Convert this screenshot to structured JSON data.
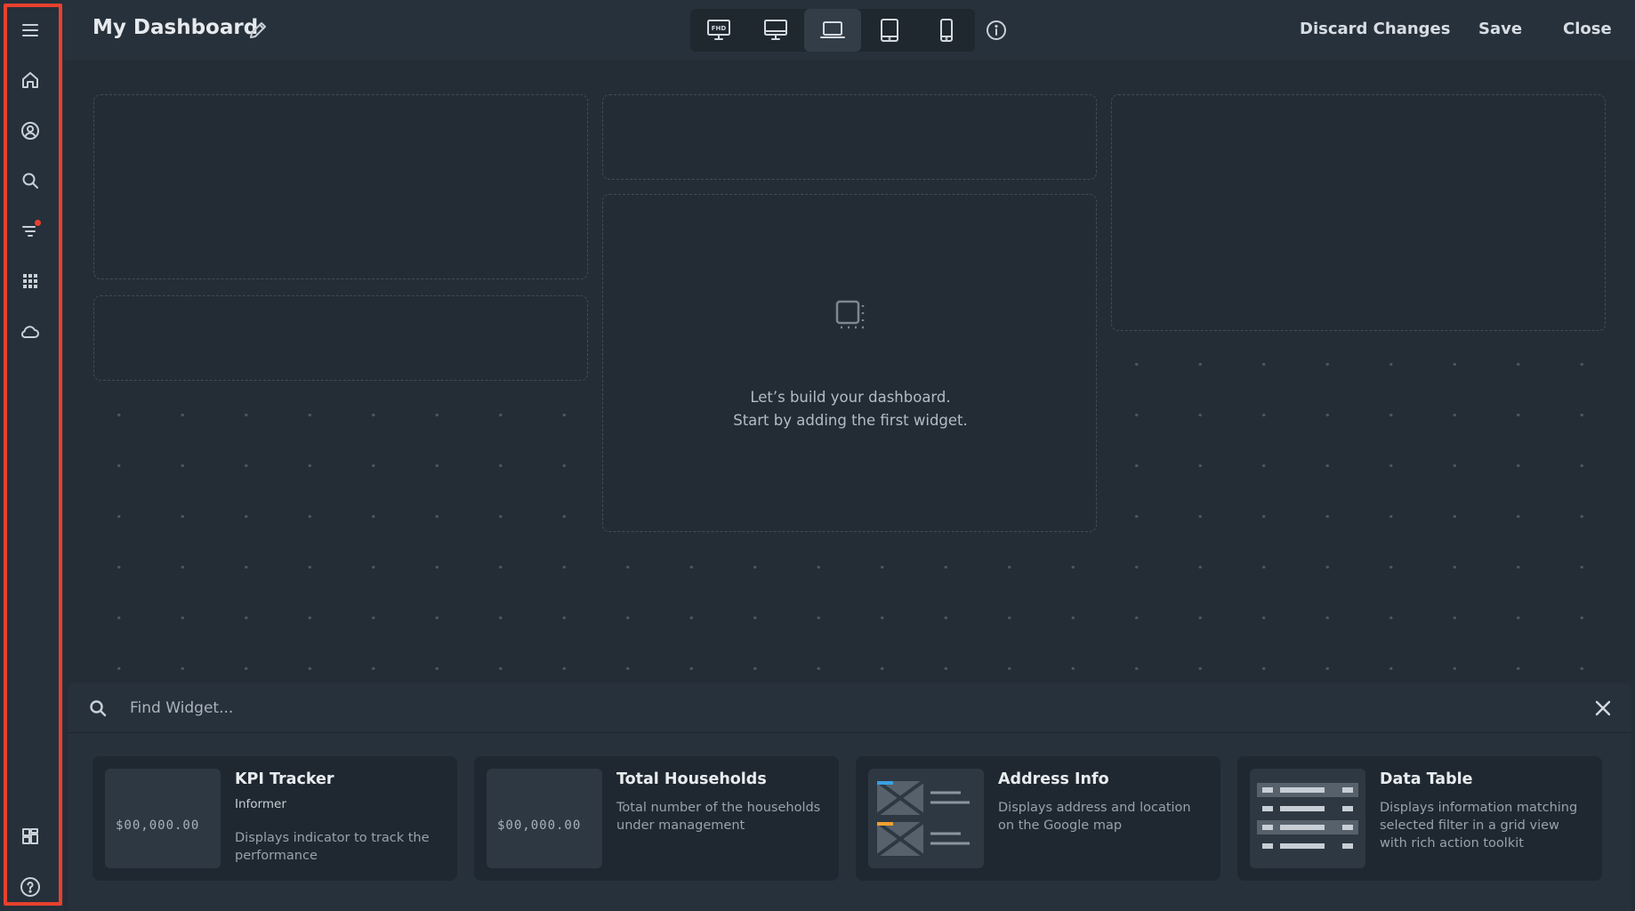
{
  "sidebar": {
    "items": [
      {
        "name": "menu-icon"
      },
      {
        "name": "home-icon"
      },
      {
        "name": "user-circle-icon"
      },
      {
        "name": "search-icon"
      },
      {
        "name": "filter-icon"
      },
      {
        "name": "apps-grid-icon"
      },
      {
        "name": "cloud-icon"
      },
      {
        "name": "widgets-icon"
      },
      {
        "name": "help-icon"
      }
    ],
    "highlight_color": "#e8412e",
    "notification_dot_color": "#e8412e"
  },
  "header": {
    "title": "My Dashboard",
    "devices": [
      {
        "name": "fhd-screen",
        "label": "FHD",
        "active": false
      },
      {
        "name": "desktop",
        "active": false
      },
      {
        "name": "laptop",
        "active": true
      },
      {
        "name": "tablet",
        "active": false
      },
      {
        "name": "phone",
        "active": false
      }
    ],
    "discard_label": "Discard Changes",
    "save_label": "Save",
    "close_label": "Close"
  },
  "canvas": {
    "empty_line1": "Let’s build your dashboard.",
    "empty_line2": "Start by adding the first widget."
  },
  "widget_panel": {
    "search_placeholder": "Find Widget...",
    "cards": [
      {
        "title": "KPI Tracker",
        "subtitle": "Informer",
        "description": "Displays indicator to track the performance",
        "thumb_text": "$00,000.00"
      },
      {
        "title": "Total Households",
        "description": "Total number of the households under management",
        "thumb_text": "$00,000.00"
      },
      {
        "title": "Address Info",
        "description": "Displays address and location on the Google map"
      },
      {
        "title": "Data Table",
        "description": "Displays information matching selected filter in a grid view with rich action toolkit"
      }
    ]
  },
  "colors": {
    "background": "#242d36",
    "header": "#27313b",
    "card": "#1f2831",
    "accent_blue": "#3aa0e0",
    "accent_orange": "#f0a030"
  }
}
